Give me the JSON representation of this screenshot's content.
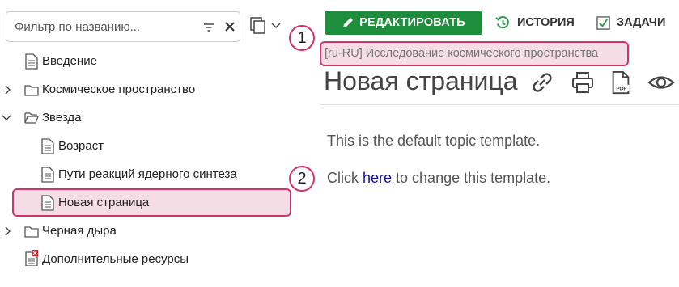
{
  "filter": {
    "placeholder": "Фильтр по названию..."
  },
  "tree": [
    {
      "label": "Введение",
      "icon": "page-icon",
      "expandable": false
    },
    {
      "label": "Космическое пространство",
      "icon": "folder-icon",
      "expandable": true,
      "expanded": false
    },
    {
      "label": "Звезда",
      "icon": "folder-open-icon",
      "expandable": true,
      "expanded": true
    },
    {
      "label": "Возраст",
      "icon": "page-icon",
      "expandable": false
    },
    {
      "label": "Пути реакций ядерного синтеза",
      "icon": "page-icon",
      "expandable": false
    },
    {
      "label": "Новая страница",
      "icon": "page-icon",
      "expandable": false,
      "selected": true
    },
    {
      "label": "Черная дыра",
      "icon": "folder-icon",
      "expandable": true,
      "expanded": false
    },
    {
      "label": "Дополнительные ресурсы",
      "icon": "page-error-icon",
      "expandable": false
    }
  ],
  "toolbar": {
    "edit_label": "РЕДАКТИРОВАТЬ",
    "history_label": "ИСТОРИЯ",
    "tasks_label": "ЗАДАЧИ"
  },
  "callouts": {
    "one": "1",
    "two": "2"
  },
  "breadcrumb": "[ru-RU] Исследование космического пространства",
  "page_title": "Новая страница",
  "content": {
    "line1": "This is the default topic template.",
    "line2_before": "Click ",
    "line2_link": "here",
    "line2_after": " to change this template."
  },
  "colors": {
    "accent_green": "#1f8e3c",
    "highlight_pink": "#d4326d",
    "highlight_fill": "#f5dde6",
    "history_green": "#2e9b52"
  }
}
